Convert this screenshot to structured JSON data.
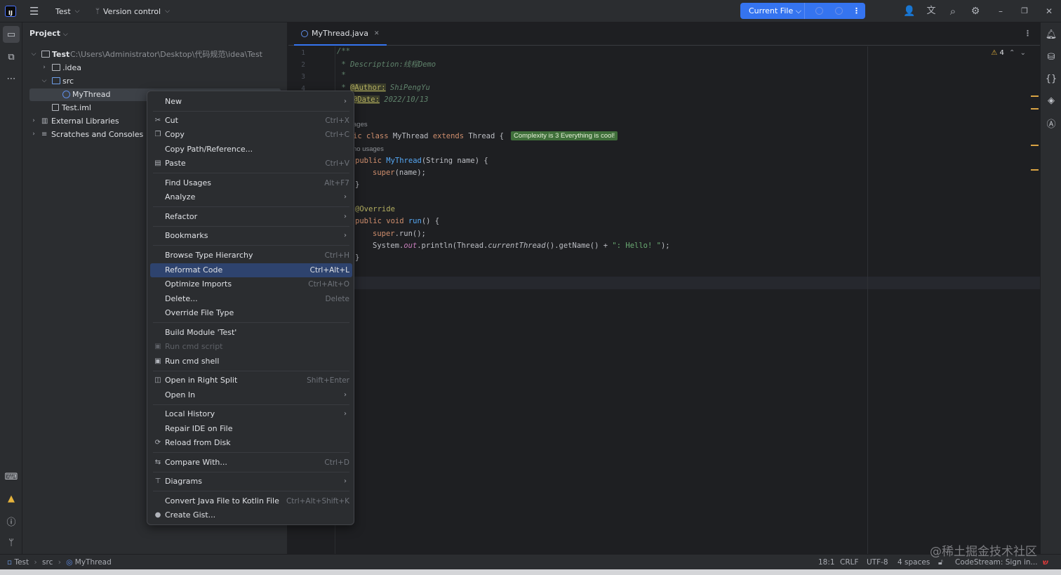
{
  "titlebar": {
    "project": "Test",
    "vcs": "Version control",
    "run_config": "Current File"
  },
  "project_panel": {
    "title": "Project",
    "tree": [
      {
        "label": "Test",
        "path": "C:\\Users\\Administrator\\Desktop\\代码规范\\idea\\Test"
      },
      {
        "label": ".idea"
      },
      {
        "label": "src"
      },
      {
        "label": "MyThread"
      },
      {
        "label": "Test.iml"
      },
      {
        "label": "External Libraries"
      },
      {
        "label": "Scratches and Consoles"
      }
    ]
  },
  "editor": {
    "tab": "MyThread.java",
    "warnings": "4",
    "line_numbers": [
      "1",
      "2",
      "3",
      "4"
    ],
    "lines": {
      "l1": "/**",
      "l2_prefix": " * Description:",
      "l2_value": "线程Demo",
      "l3": " *",
      "l4_prefix": " * ",
      "l4_tag": "@Author:",
      "l4_value": " ShiPengYu",
      "l5_tag": "@Date:",
      "l5_value": " 2022/10/13",
      "usages1": "ages",
      "l7_kw": "ic class ",
      "l7_name": "MyThread ",
      "l7_ext": "extends ",
      "l7_rest": "Thread {",
      "complexity": "Complexity is 3 Everything is cool!",
      "usages2": "no usages",
      "l8_kw": "public ",
      "l8_name": "MyThread",
      "l8_rest": "(String name) {",
      "l9_kw": "super",
      "l9_rest": "(name);",
      "l10": "}",
      "l12": "@Override",
      "l13_kw": "public void ",
      "l13_name": "run",
      "l13_rest": "() {",
      "l14_kw": "super",
      "l14_rest": ".run();",
      "l15_a": "System.",
      "l15_out": "out",
      "l15_b": ".println(Thread.",
      "l15_c": "currentThread",
      "l15_d": "().getName() + ",
      "l15_str": "\": Hello! \"",
      "l15_e": ");",
      "l16": "}"
    }
  },
  "context_menu": {
    "items": [
      {
        "label": "New",
        "shortcut": "",
        "submenu": true
      },
      {
        "label": "Cut",
        "shortcut": "Ctrl+X"
      },
      {
        "label": "Copy",
        "shortcut": "Ctrl+C"
      },
      {
        "label": "Copy Path/Reference...",
        "shortcut": ""
      },
      {
        "label": "Paste",
        "shortcut": "Ctrl+V"
      },
      {
        "label": "Find Usages",
        "shortcut": "Alt+F7"
      },
      {
        "label": "Analyze",
        "shortcut": "",
        "submenu": true
      },
      {
        "label": "Refactor",
        "shortcut": "",
        "submenu": true
      },
      {
        "label": "Bookmarks",
        "shortcut": "",
        "submenu": true
      },
      {
        "label": "Browse Type Hierarchy",
        "shortcut": "Ctrl+H"
      },
      {
        "label": "Reformat Code",
        "shortcut": "Ctrl+Alt+L",
        "highlighted": true
      },
      {
        "label": "Optimize Imports",
        "shortcut": "Ctrl+Alt+O"
      },
      {
        "label": "Delete...",
        "shortcut": "Delete"
      },
      {
        "label": "Override File Type",
        "shortcut": ""
      },
      {
        "label": "Build Module 'Test'",
        "shortcut": ""
      },
      {
        "label": "Run cmd script",
        "shortcut": "",
        "disabled": true
      },
      {
        "label": "Run cmd shell",
        "shortcut": ""
      },
      {
        "label": "Open in Right Split",
        "shortcut": "Shift+Enter"
      },
      {
        "label": "Open In",
        "shortcut": "",
        "submenu": true
      },
      {
        "label": "Local History",
        "shortcut": "",
        "submenu": true
      },
      {
        "label": "Repair IDE on File",
        "shortcut": ""
      },
      {
        "label": "Reload from Disk",
        "shortcut": ""
      },
      {
        "label": "Compare With...",
        "shortcut": "Ctrl+D"
      },
      {
        "label": "Diagrams",
        "shortcut": "",
        "submenu": true
      },
      {
        "label": "Convert Java File to Kotlin File",
        "shortcut": "Ctrl+Alt+Shift+K"
      },
      {
        "label": "Create Gist...",
        "shortcut": ""
      }
    ]
  },
  "statusbar": {
    "crumb1": "Test",
    "crumb2": "src",
    "crumb3": "MyThread",
    "position": "18:1",
    "line_sep": "CRLF",
    "encoding": "UTF-8",
    "indent": "4 spaces",
    "plugin": "CodeStream: Sign in..."
  },
  "watermark": "@稀土掘金技术社区",
  "colors": {
    "accent": "#3574f0",
    "highlight": "#2e436e",
    "background": "#1e1f22",
    "panel": "#2b2d30"
  }
}
